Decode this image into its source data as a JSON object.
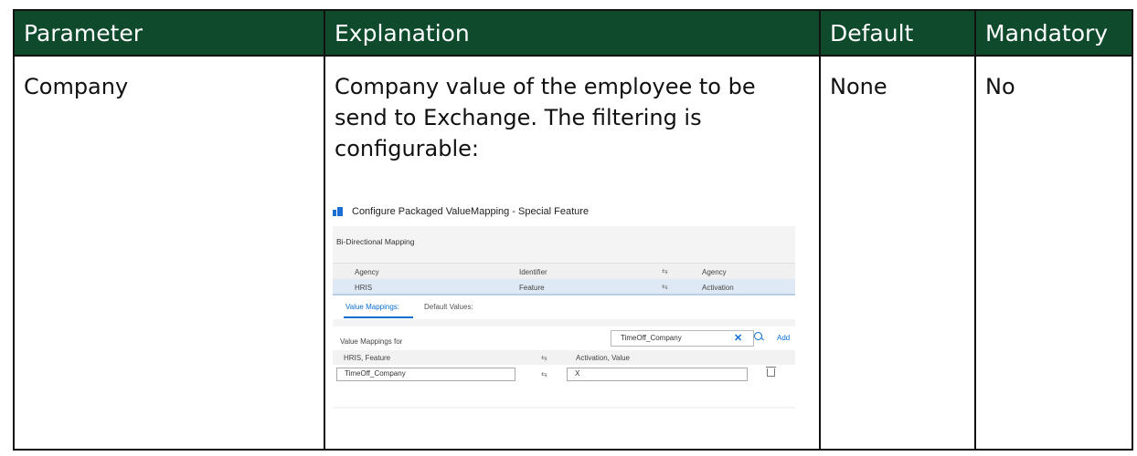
{
  "table": {
    "headers": [
      "Parameter",
      "Explanation",
      "Default",
      "Mandatory"
    ],
    "row": {
      "parameter": "Company",
      "explanation": "Company value of the employee to be send to Exchange. The filtering is configurable:",
      "default": "None",
      "mandatory": "No"
    }
  },
  "screenshot": {
    "title": "Configure Packaged ValueMapping - Special Feature",
    "section_label": "Bi-Directional Mapping",
    "mapping_header": [
      "Agency",
      "Identifier",
      "Agency"
    ],
    "mapping_row": [
      "HRIS",
      "Feature",
      "Activation"
    ],
    "arrow_glyph": "⇆",
    "tabs": [
      "Value Mappings:",
      "Default Values:"
    ],
    "value_mappings_for_label": "Value Mappings for",
    "search_value": "TimeOff_Company",
    "clear_glyph": "✕",
    "add_label": "Add",
    "vm_header": [
      "HRIS, Feature",
      "Activation, Value"
    ],
    "vm_row": [
      "TimeOff_Company",
      "X"
    ],
    "colors": {
      "header_bg": "#0e4a2b",
      "accent": "#0a6ed1",
      "row_selected": "#dfe9f5"
    },
    "icons": [
      "app-icon",
      "swap-arrows-icon",
      "clear-icon",
      "search-icon",
      "trash-icon"
    ]
  }
}
